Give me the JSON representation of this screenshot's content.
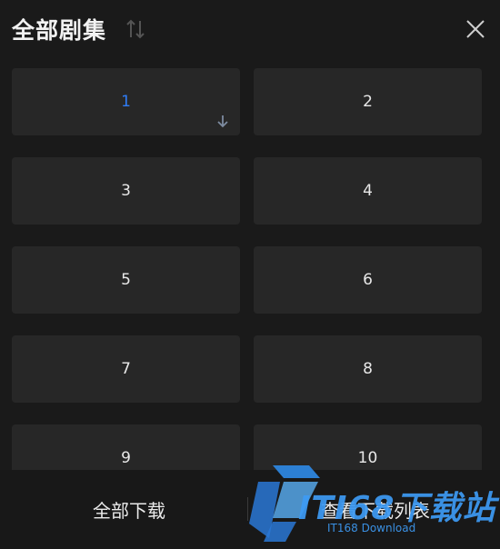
{
  "header": {
    "title": "全部剧集"
  },
  "episodes": [
    "1",
    "2",
    "3",
    "4",
    "5",
    "6",
    "7",
    "8",
    "9",
    "10"
  ],
  "active_episode": "1",
  "footer": {
    "download_all": "全部下载",
    "view_download_list": "查看下载列表"
  },
  "watermark": {
    "brand": "ITI68下载站",
    "subtitle": "IT168 Download"
  },
  "colors": {
    "background": "#1a1a1a",
    "tile": "#272727",
    "active": "#2f7cf6",
    "watermark": "#3d9bf5"
  }
}
